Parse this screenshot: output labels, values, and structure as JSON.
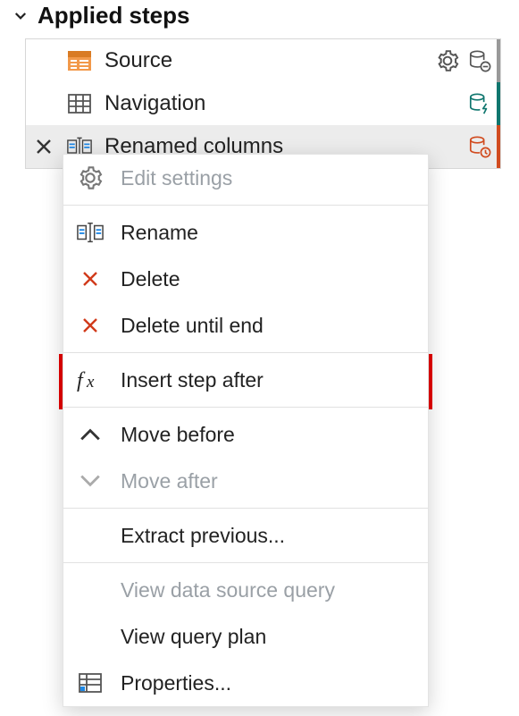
{
  "header": {
    "title": "Applied steps"
  },
  "steps": [
    {
      "label": "Source"
    },
    {
      "label": "Navigation"
    },
    {
      "label": "Renamed columns"
    }
  ],
  "menu": {
    "edit_settings": "Edit settings",
    "rename": "Rename",
    "delete": "Delete",
    "delete_until_end": "Delete until end",
    "insert_step_after": "Insert step after",
    "move_before": "Move before",
    "move_after": "Move after",
    "extract_previous": "Extract previous...",
    "view_data_source_query": "View data source query",
    "view_query_plan": "View query plan",
    "properties": "Properties..."
  }
}
